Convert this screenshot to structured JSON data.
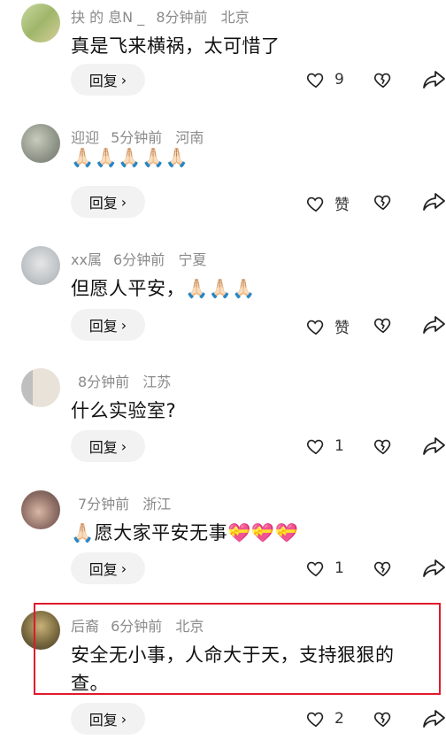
{
  "comments": [
    {
      "username": "抉 的 息N _",
      "time": "8分钟前",
      "location": "北京",
      "text": "真是飞来横祸，太可惜了",
      "reply_label": "回复",
      "like_count": "9"
    },
    {
      "username": "迎迎",
      "time": "5分钟前",
      "location": "河南",
      "text": "🙏🏻🙏🏻🙏🏻🙏🏻🙏🏻",
      "reply_label": "回复",
      "like_count": "赞"
    },
    {
      "username": "xx属",
      "time": "6分钟前",
      "location": "宁夏",
      "text": "但愿人平安，🙏🏻🙏🏻🙏🏻",
      "reply_label": "回复",
      "like_count": "赞"
    },
    {
      "username": "",
      "time": "8分钟前",
      "location": "江苏",
      "text": "什么实验室?",
      "reply_label": "回复",
      "like_count": "1"
    },
    {
      "username": "",
      "time": "7分钟前",
      "location": "浙江",
      "text": "🙏🏻愿大家平安无事💝💝💝",
      "reply_label": "回复",
      "like_count": "1"
    },
    {
      "username": "后裔",
      "time": "6分钟前",
      "location": "北京",
      "text_line1": "安全无小事，人命大于天，支持狠狠的",
      "text_line2": "查。",
      "reply_label": "回复",
      "like_count": "2"
    }
  ],
  "icons": {
    "like": "heart-outline-icon",
    "dislike": "broken-heart-icon",
    "share": "share-arrow-icon",
    "reply_chevron": "chevron-right-icon"
  },
  "colors": {
    "meta_text": "#8a8a8a",
    "reply_bg": "#f2f2f2",
    "highlight_border": "#e0192b"
  }
}
